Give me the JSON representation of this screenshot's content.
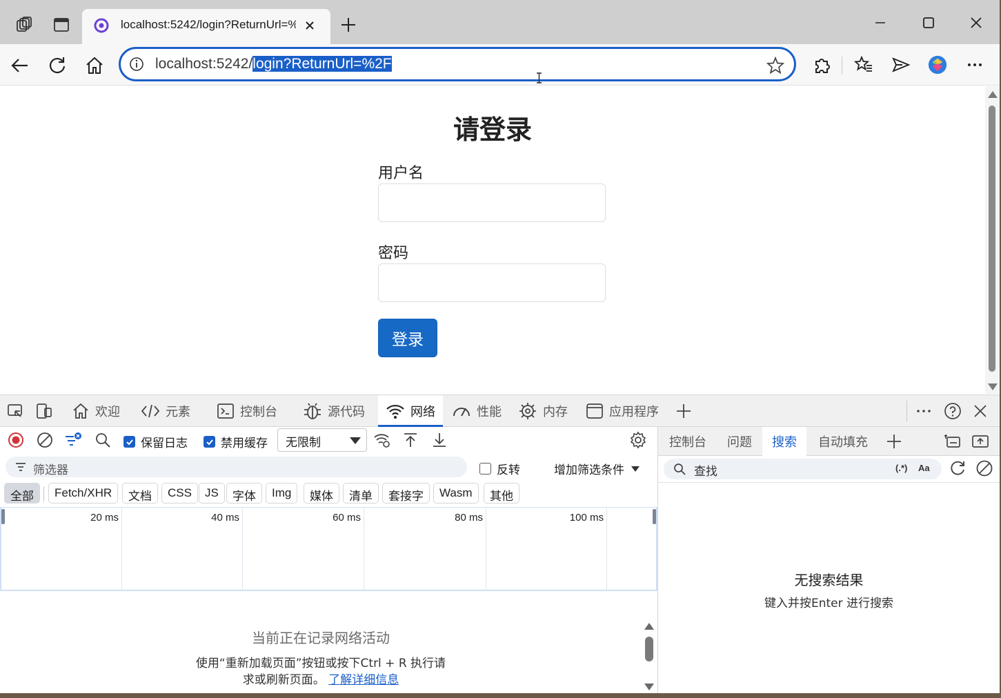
{
  "browser": {
    "tab_title": "localhost:5242/login?ReturnUrl=%2F",
    "address": {
      "prefix": "localhost:5242/",
      "selected": "login?ReturnUrl=%2F"
    }
  },
  "page": {
    "title": "请登录",
    "username_label": "用户名",
    "password_label": "密码",
    "login_button": "登录"
  },
  "devtools": {
    "tabs": [
      {
        "label": "欢迎",
        "icon": "home-icon"
      },
      {
        "label": "元素",
        "icon": "code-icon"
      },
      {
        "label": "控制台",
        "icon": "console-icon"
      },
      {
        "label": "源代码",
        "icon": "bug-icon"
      },
      {
        "label": "网络",
        "icon": "wifi-icon",
        "active": true
      },
      {
        "label": "性能",
        "icon": "gauge-icon"
      },
      {
        "label": "内存",
        "icon": "chip-icon"
      },
      {
        "label": "应用程序",
        "icon": "app-icon"
      }
    ],
    "network": {
      "preserve_log": "保留日志",
      "disable_cache": "禁用缓存",
      "throttle": "无限制",
      "filter_placeholder": "筛选器",
      "invert": "反转",
      "add_filter": "增加筛选条件",
      "types": [
        "全部",
        "Fetch/XHR",
        "文档",
        "CSS",
        "JS",
        "字体",
        "Img",
        "媒体",
        "清单",
        "套接字",
        "Wasm",
        "其他"
      ],
      "timeline_labels": [
        "20 ms",
        "40 ms",
        "60 ms",
        "80 ms",
        "100 ms"
      ],
      "empty_title": "当前正在记录网络活动",
      "empty_desc_1": "使用“重新加载页面”按钮或按下Ctrl + R 执行请",
      "empty_desc_2": "求或刷新页面。",
      "learn_more": "了解详细信息"
    },
    "drawer": {
      "tabs": [
        "控制台",
        "问题",
        "搜索",
        "自动填充"
      ],
      "active_tab": "搜索",
      "search_placeholder": "查找",
      "regex_label": "(.*)",
      "case_label": "Aa",
      "no_results": "无搜索结果",
      "hint": "键入并按Enter 进行搜索"
    }
  },
  "colors": {
    "accent": "#1a5fc8",
    "login_button": "#1769c6"
  }
}
